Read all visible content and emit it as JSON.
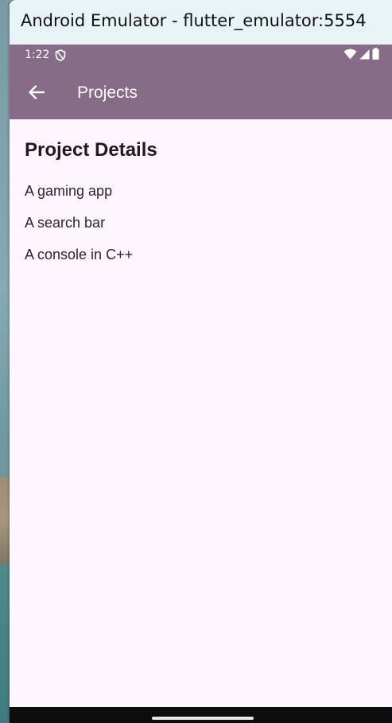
{
  "window": {
    "title": "Android Emulator - flutter_emulator:5554"
  },
  "statusbar": {
    "time": "1:22",
    "left_icon": "shield-icon",
    "right_icons": [
      "wifi-icon",
      "signal-icon",
      "battery-icon"
    ]
  },
  "appbar": {
    "title": "Projects",
    "back_icon": "arrow-back-icon"
  },
  "content": {
    "heading": "Project Details",
    "items": [
      {
        "label": "A gaming app"
      },
      {
        "label": "A search bar"
      },
      {
        "label": "A console in C++"
      }
    ]
  },
  "colors": {
    "primary": "#866c87",
    "background": "#fdf7fd",
    "title_bar": "#e8f3f5",
    "nav_bar": "#0d0d0d"
  }
}
